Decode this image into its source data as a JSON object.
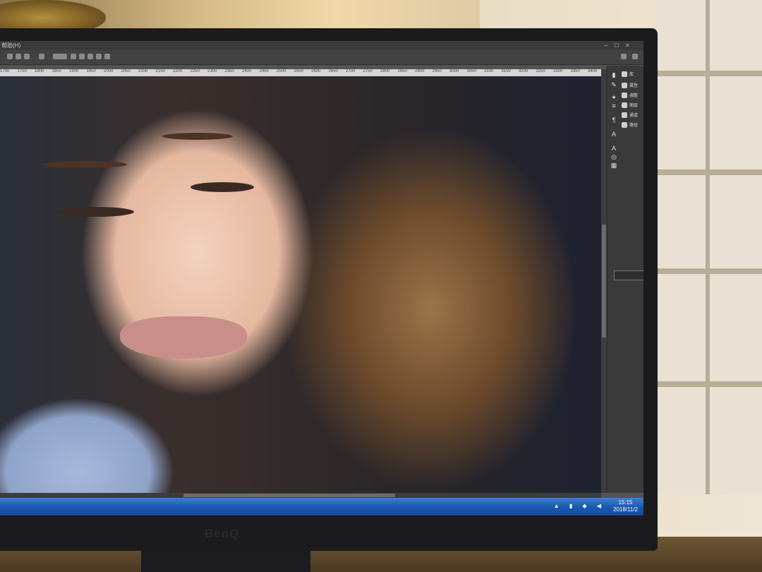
{
  "monitor": {
    "brand": "BenQ"
  },
  "photoshop": {
    "title": "帮助(H)",
    "ruler_ticks": [
      "1700",
      "1750",
      "1800",
      "1850",
      "1900",
      "1950",
      "2000",
      "2050",
      "2100",
      "2150",
      "2200",
      "2250",
      "2300",
      "2350",
      "2400",
      "2450",
      "2500",
      "2550",
      "2600",
      "2650",
      "2700",
      "2750",
      "2800",
      "2850",
      "2900",
      "2950",
      "3000",
      "3050",
      "3100",
      "3150",
      "3200",
      "3250",
      "3300",
      "3350",
      "3400"
    ],
    "panels": [
      {
        "icon": "library-icon",
        "label": "库"
      },
      {
        "icon": "properties-icon",
        "label": "属性"
      },
      {
        "icon": "adjustments-icon",
        "label": "调整"
      },
      {
        "icon": "layers-icon",
        "label": "图层"
      },
      {
        "icon": "channels-icon",
        "label": "通道"
      },
      {
        "icon": "paths-icon",
        "label": "路径"
      }
    ]
  },
  "taskbar": {
    "time": "15:15",
    "date": "2018/11/2"
  }
}
